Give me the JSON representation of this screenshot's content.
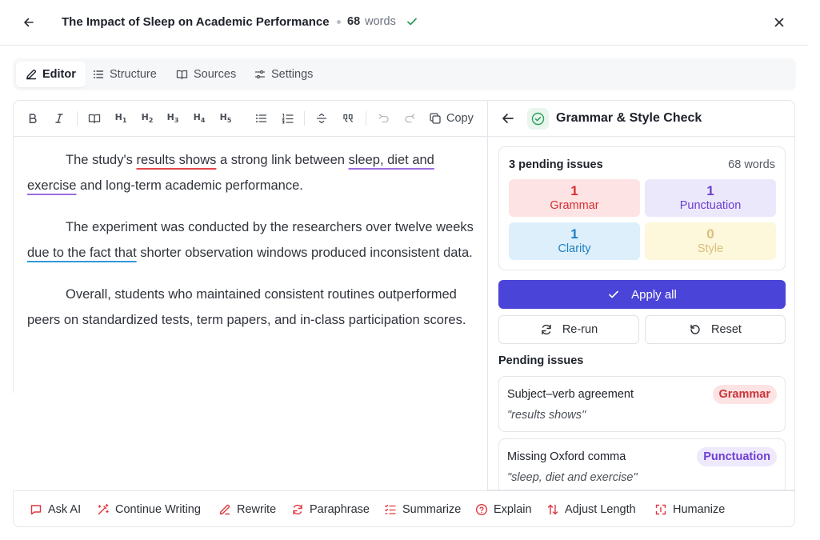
{
  "header": {
    "title": "The Impact of Sleep on Academic Performance",
    "word_count": "68",
    "word_label": "words"
  },
  "tabs": [
    {
      "label": "Editor",
      "active": true,
      "icon": "pencil-icon"
    },
    {
      "label": "Structure",
      "active": false,
      "icon": "list-icon"
    },
    {
      "label": "Sources",
      "active": false,
      "icon": "book-icon"
    },
    {
      "label": "Settings",
      "active": false,
      "icon": "sliders-icon"
    }
  ],
  "toolbar": {
    "copy_label": "Copy",
    "headings": [
      "H1",
      "H2",
      "H3",
      "H4",
      "H5"
    ]
  },
  "editor": {
    "p1": {
      "a": "The study's ",
      "b": "results shows",
      "c": " a strong link between ",
      "d": "sleep, diet and ",
      "e": "exercise",
      "f": " and long-term academic performance."
    },
    "p2": {
      "a": "The experiment was conducted by the researchers over twelve weeks ",
      "b": "due to the fact that",
      "c": " shorter observation windows produced inconsistent data."
    },
    "p3": {
      "a": "Overall, students who maintained consistent routines outperformed peers on standardized tests, term papers, and in-class participation scores."
    }
  },
  "panel": {
    "title": "Grammar & Style Check",
    "summary": {
      "pending": "3 pending issues",
      "words": "68 words",
      "stats": [
        {
          "count": "1",
          "label": "Grammar",
          "bg": "#fde3e3",
          "fg": "#d62f35"
        },
        {
          "count": "1",
          "label": "Punctuation",
          "bg": "#ece8fc",
          "fg": "#6b3fd1"
        },
        {
          "count": "1",
          "label": "Clarity",
          "bg": "#dceffb",
          "fg": "#1f7fbf"
        },
        {
          "count": "0",
          "label": "Style",
          "bg": "#fdf7dc",
          "fg": "#d9c07a"
        }
      ]
    },
    "apply_all": "Apply all",
    "rerun": "Re-run",
    "reset": "Reset",
    "pending_heading": "Pending issues",
    "issues": [
      {
        "title": "Subject–verb agreement",
        "quote": "\"results shows\"",
        "badge": "Grammar",
        "badge_bg": "#fde3e3",
        "badge_fg": "#c9353a"
      },
      {
        "title": "Missing Oxford comma",
        "quote": "\"sleep, diet and exercise\"",
        "badge": "Punctuation",
        "badge_bg": "#efe9fd",
        "badge_fg": "#6f3fd3"
      }
    ]
  },
  "ai_actions": [
    {
      "label": "Ask AI",
      "icon": "chat-icon"
    },
    {
      "label": "Continue Writing",
      "icon": "magic-wand-icon"
    },
    {
      "label": "Rewrite",
      "icon": "pen-icon"
    },
    {
      "label": "Paraphrase",
      "icon": "refresh-icon"
    },
    {
      "label": "Summarize",
      "icon": "list-check-icon"
    },
    {
      "label": "Explain",
      "icon": "help-circle-icon"
    },
    {
      "label": "Adjust Length",
      "icon": "arrows-vertical-icon"
    },
    {
      "label": "Humanize",
      "icon": "scan-icon"
    }
  ],
  "colors": {
    "accent": "#4b44d8",
    "ai_icon": "#e0363f",
    "success": "#2e9e5b"
  }
}
